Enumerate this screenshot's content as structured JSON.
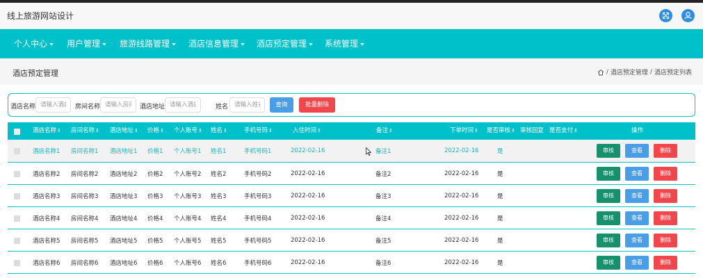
{
  "app": {
    "title": "线上旅游网站设计"
  },
  "header_icons": [
    "expand-icon",
    "user-icon"
  ],
  "nav": {
    "items": [
      "个人中心",
      "用户管理",
      "旅游线路管理",
      "酒店信息管理",
      "酒店预定管理",
      "系统管理"
    ]
  },
  "page": {
    "title": "酒店预定管理"
  },
  "breadcrumb": {
    "items": [
      "酒店预定管理",
      "酒店预定列表"
    ],
    "separator": "/"
  },
  "search": {
    "fields": [
      {
        "label": "酒店名称",
        "placeholder": "请输入酒店"
      },
      {
        "label": "房间名称",
        "placeholder": "请输入房间"
      },
      {
        "label": "酒店地址",
        "placeholder": "请输入酒店"
      },
      {
        "label": "姓名",
        "placeholder": "请输入姓名"
      }
    ],
    "search_label": "查询",
    "batch_delete_label": "批量删除"
  },
  "table": {
    "headers": [
      "酒店名称",
      "房间名称",
      "酒店地址",
      "价格",
      "个人账号",
      "姓名",
      "手机号码",
      "入住时间",
      "备注",
      "下单时间",
      "是否审核",
      "审核回复",
      "是否支付",
      "操作"
    ],
    "sort_glyph": "⇕",
    "actions": {
      "review": "审核",
      "view": "查看",
      "delete": "删除"
    },
    "rows": [
      [
        "酒店名称1",
        "房间名称1",
        "酒店地址1",
        "价格1",
        "个人账号1",
        "姓名1",
        "手机号码1",
        "2022-02-16",
        "备注1",
        "2022-02-16",
        "是"
      ],
      [
        "酒店名称2",
        "房间名称2",
        "酒店地址2",
        "价格2",
        "个人账号2",
        "姓名2",
        "手机号码2",
        "2022-02-16",
        "备注2",
        "2022-02-16",
        "是"
      ],
      [
        "酒店名称3",
        "房间名称3",
        "酒店地址3",
        "价格3",
        "个人账号3",
        "姓名3",
        "手机号码3",
        "2022-02-16",
        "备注3",
        "2022-02-16",
        "是"
      ],
      [
        "酒店名称4",
        "房间名称4",
        "酒店地址4",
        "价格4",
        "个人账号4",
        "姓名4",
        "手机号码4",
        "2022-02-16",
        "备注4",
        "2022-02-16",
        "是"
      ],
      [
        "酒店名称5",
        "房间名称5",
        "酒店地址5",
        "价格5",
        "个人账号5",
        "姓名5",
        "手机号码5",
        "2022-02-16",
        "备注5",
        "2022-02-16",
        "是"
      ],
      [
        "酒店名称6",
        "房间名称6",
        "酒店地址6",
        "价格6",
        "个人账号6",
        "姓名6",
        "手机号码6",
        "2022-02-16",
        "备注6",
        "2022-02-16",
        "是"
      ]
    ]
  },
  "colors": {
    "accent": "#00c1c9",
    "primary_button": "#4a9ee8",
    "danger_button": "#f2464d",
    "review_button": "#15916e"
  }
}
